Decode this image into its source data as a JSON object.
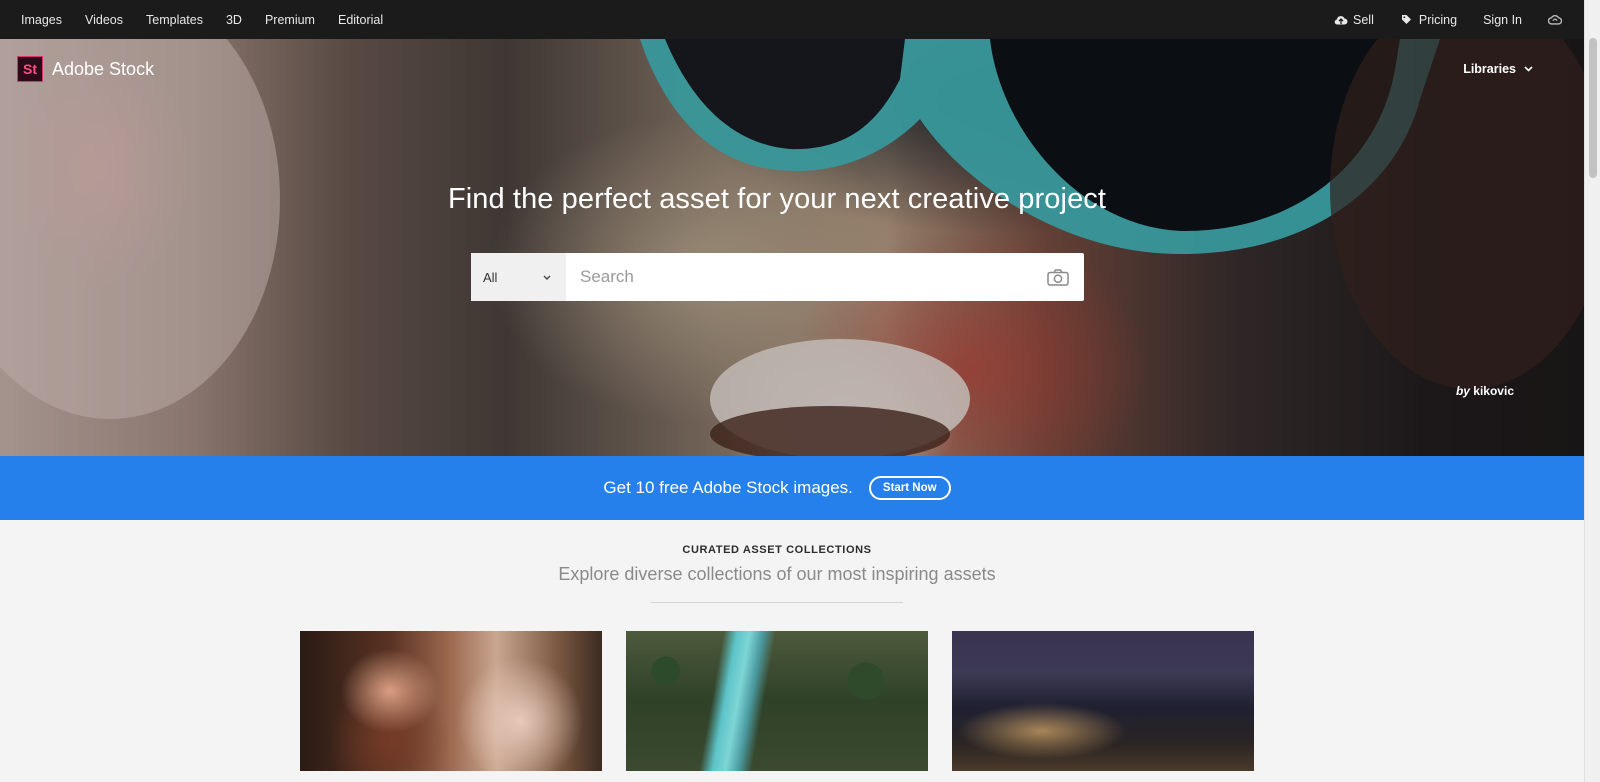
{
  "topnav": {
    "left_items": [
      "Images",
      "Videos",
      "Templates",
      "3D",
      "Premium",
      "Editorial"
    ],
    "sell_label": "Sell",
    "pricing_label": "Pricing",
    "signin_label": "Sign In"
  },
  "hero": {
    "logo_mark": "St",
    "logo_name": "Adobe Stock",
    "libraries_label": "Libraries",
    "headline": "Find the perfect asset for your next creative project",
    "search": {
      "category": "All",
      "placeholder": "Search"
    },
    "credit_by": "by",
    "credit_author": "kikovic"
  },
  "promo": {
    "text": "Get 10 free Adobe Stock images.",
    "button": "Start Now"
  },
  "curated": {
    "eyebrow": "CURATED ASSET COLLECTIONS",
    "subtitle": "Explore diverse collections of our most inspiring assets"
  },
  "icons": {
    "sell": "cloud-upload-icon",
    "pricing": "tag-icon",
    "creative_cloud": "creative-cloud-icon",
    "camera": "camera-icon",
    "chevron": "chevron-down-icon"
  },
  "colors": {
    "topnav_bg": "#1b1b1b",
    "promo_bg": "#2680eb",
    "logo_accent": "#e2326b"
  }
}
